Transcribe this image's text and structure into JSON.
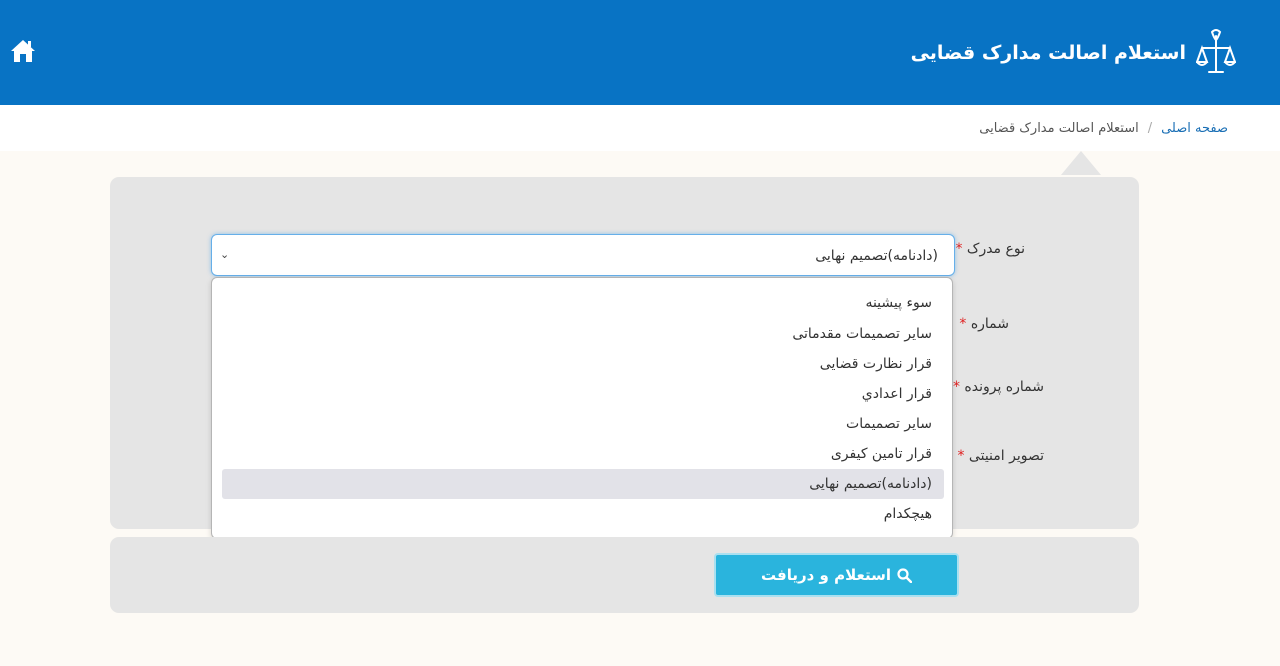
{
  "header": {
    "title": "استعلام اصالت مدارک قضایی",
    "home_icon": "home-icon",
    "logo_icon": "scales-of-justice-logo",
    "bg_color": "#0873c4"
  },
  "breadcrumb": {
    "home_label": "صفحه اصلی",
    "separator": "/",
    "current_label": "استعلام اصالت مدارک قضایی"
  },
  "form": {
    "document_type": {
      "label": "نوع مدرک",
      "required_mark": "*",
      "selected_value": "(دادنامه)تصمیم نهایی",
      "arrow_icon": "chevron-down-icon",
      "options": [
        "سوء پیشینه",
        "سایر تصمیمات مقدماتی",
        "قرار نظارت قضایی",
        "قرار اعدادي",
        "سایر تصمیمات",
        "قرار تامین کیفری",
        "(دادنامه)تصمیم نهایی",
        "هیچکدام"
      ],
      "highlighted_index": 6
    },
    "number": {
      "label": "شماره",
      "required_mark": "*"
    },
    "case_number": {
      "label": "شماره پرونده",
      "required_mark": "*"
    },
    "captcha": {
      "label": "تصویر امنیتی",
      "required_mark": "*"
    },
    "submit": {
      "label": "استعلام و دریافت",
      "icon": "search-icon",
      "color": "#2ab4dd"
    }
  }
}
